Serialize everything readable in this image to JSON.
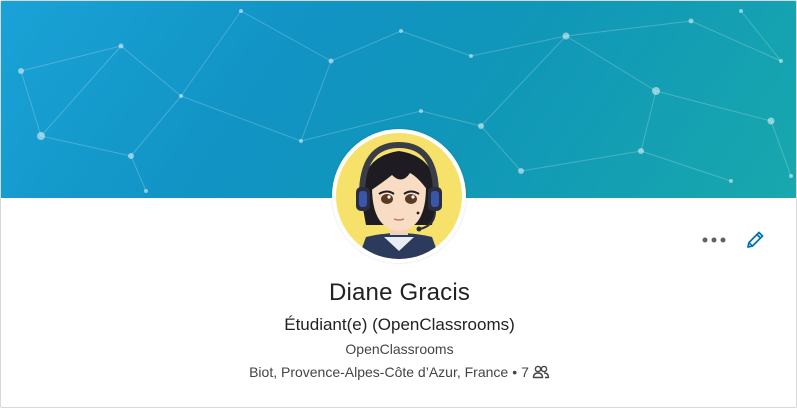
{
  "profile": {
    "name": "Diane Gracis",
    "headline": "Étudiant(e) (OpenClassrooms)",
    "company": "OpenClassrooms",
    "location": "Biot, Provence-Alpes-Côte d’Azur, France",
    "separator": "•",
    "connections": "7"
  },
  "icons": {
    "more": "more-horizontal-icon",
    "edit": "pencil-icon",
    "connections": "people-icon"
  },
  "colors": {
    "banner_start": "#1aa2d6",
    "banner_end": "#18a8ad",
    "accent": "#0073b1",
    "text_primary": "#222222",
    "text_secondary": "#444444"
  }
}
